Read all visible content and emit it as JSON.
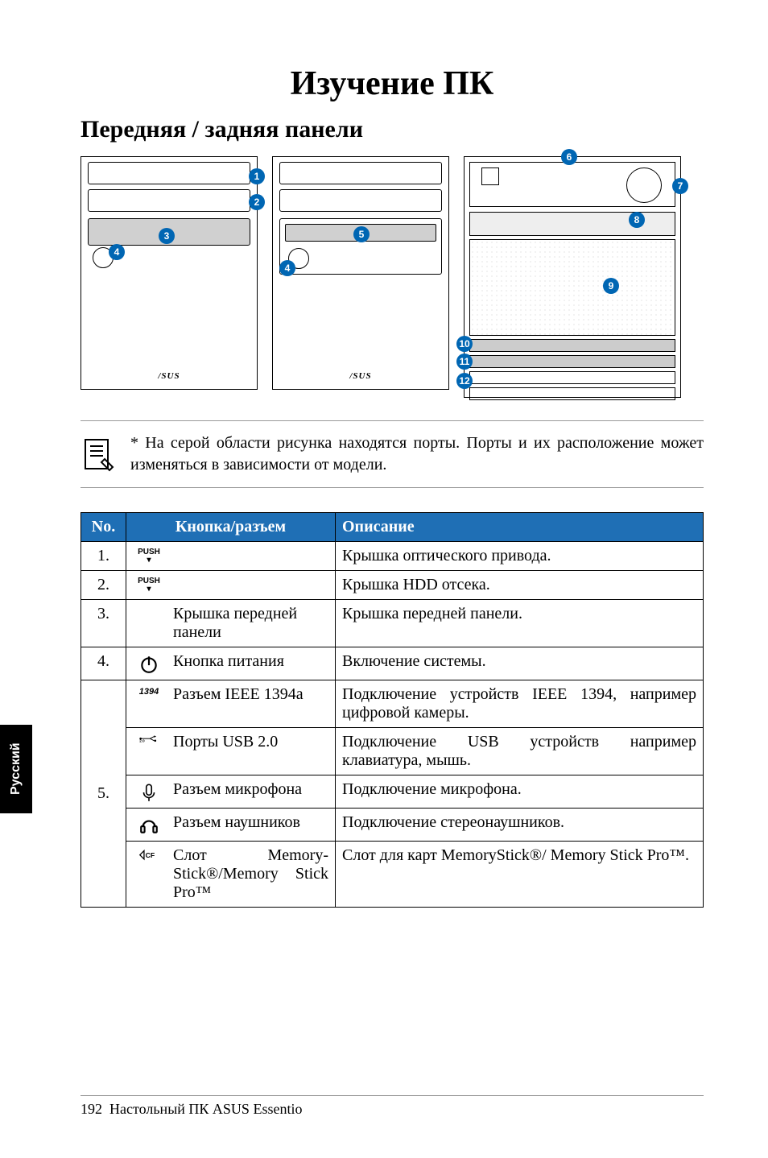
{
  "page_title": "Изучение ПК",
  "section_title": "Передняя / задняя панели",
  "diagram_logo": "/SUS",
  "note_text": "* На серой области рисунка находятся порты. Порты и их расположение может изменяться в зависимости от модели.",
  "table": {
    "headers": {
      "no": "No.",
      "button": "Кнопка/разъем",
      "desc": "Описание"
    },
    "rows": [
      {
        "no": "1.",
        "icon": "push",
        "label": "",
        "desc": "Крышка оптического привода."
      },
      {
        "no": "2.",
        "icon": "push",
        "label": "",
        "desc": "Крышка HDD отсека."
      },
      {
        "no": "3.",
        "icon": "",
        "label": "Крышка передней панели",
        "desc": "Крышка передней панели."
      },
      {
        "no": "4.",
        "icon": "power",
        "label": "Кнопка питания",
        "desc": "Включение системы."
      }
    ],
    "group5_no": "5.",
    "group5": [
      {
        "icon": "1394",
        "label": "Разъем IEEE 1394a",
        "desc": "Подключение устройств IEEE 1394, например цифровой камеры."
      },
      {
        "icon": "usb",
        "label": "Порты USB 2.0",
        "desc": "Подключение USB устройств например клавиатура, мышь."
      },
      {
        "icon": "mic",
        "label": "Разъем микрофона",
        "desc": "Подключение микрофона."
      },
      {
        "icon": "headphones",
        "label": "Разъем наушников",
        "desc": "Подключение стереонаушников."
      },
      {
        "icon": "cf",
        "label": "Слот Memory-Stick®/Memory Stick Pro™",
        "desc": "Слот для карт MemoryStick®/ Memory Stick Pro™."
      }
    ]
  },
  "callouts_front1": [
    "1",
    "2",
    "3",
    "4"
  ],
  "callouts_front2": [
    "5",
    "4"
  ],
  "callouts_back": [
    "6",
    "7",
    "8",
    "9",
    "10",
    "11",
    "12"
  ],
  "side_tab": "Русский",
  "footer": {
    "page": "192",
    "text": "Настольный ПК ASUS Essentio"
  }
}
